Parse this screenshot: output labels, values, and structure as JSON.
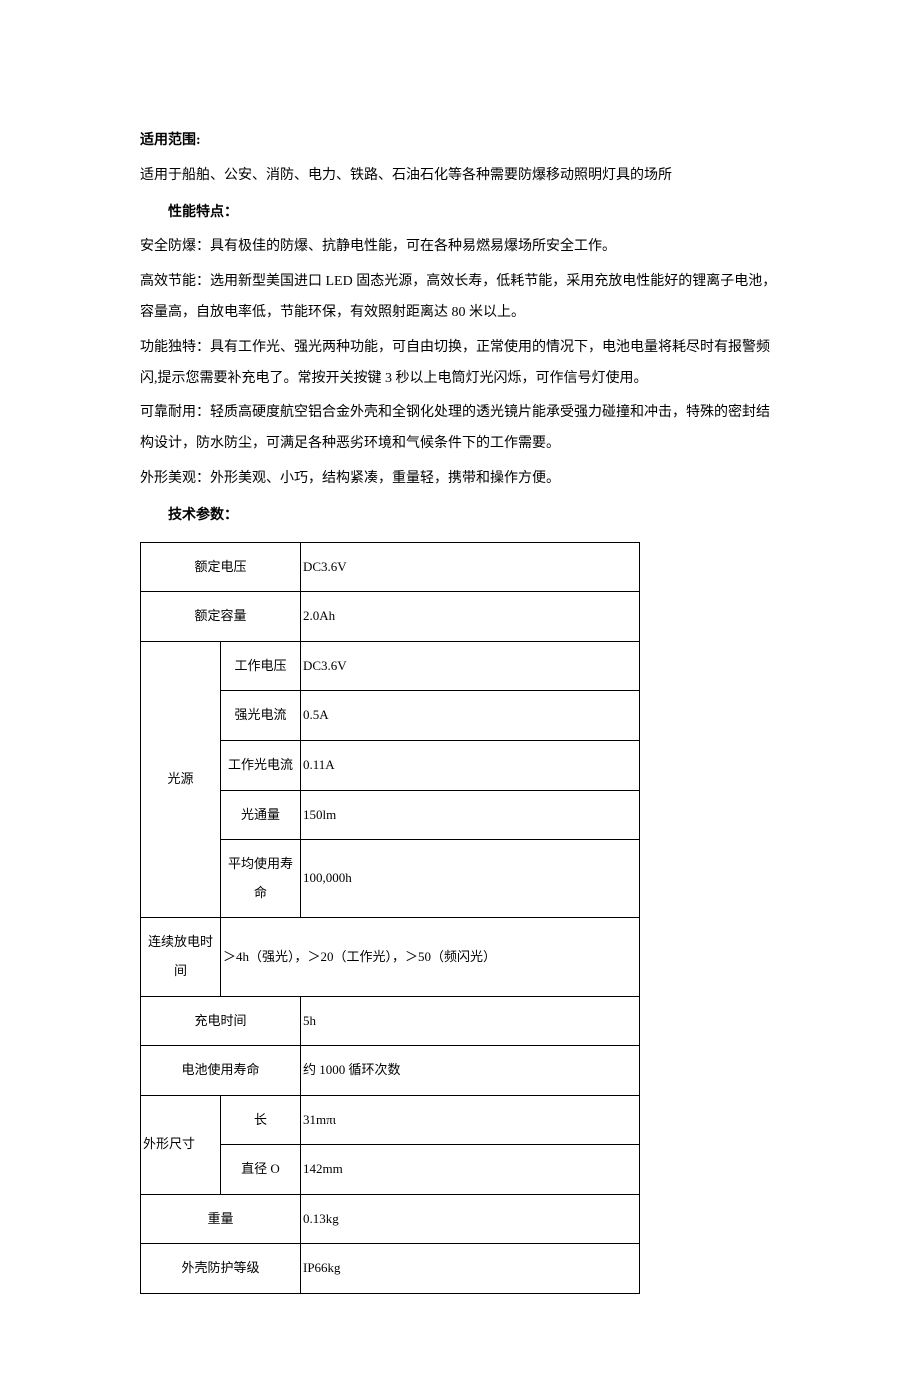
{
  "sections": {
    "scope": {
      "title": "适用范围:",
      "text": "适用于船舶、公安、消防、电力、铁路、石油石化等各种需要防爆移动照明灯具的场所"
    },
    "features": {
      "title": "性能特点：",
      "items": [
        "安全防爆：具有极佳的防爆、抗静电性能，可在各种易燃易爆场所安全工作。",
        "高效节能：选用新型美国进口 LED 固态光源，高效长寿，低耗节能，采用充放电性能好的锂离子电池，容量高，自放电率低，节能环保，有效照射距离达 80 米以上。",
        "功能独特：具有工作光、强光两种功能，可自由切换，正常使用的情况下，电池电量将耗尽时有报警频闪,提示您需要补充电了。常按开关按键 3 秒以上电筒灯光闪烁，可作信号灯使用。",
        "可靠耐用：轻质高硬度航空铝合金外壳和全钢化处理的透光镜片能承受强力碰撞和冲击，特殊的密封结构设计，防水防尘，可满足各种恶劣环境和气候条件下的工作需要。",
        "外形美观：外形美观、小巧，结构紧凑，重量轻，携带和操作方便。"
      ]
    },
    "specs": {
      "title": "技术参数：",
      "rated_voltage_label": "额定电压",
      "rated_voltage_value": "DC3.6V",
      "rated_capacity_label": "额定容量",
      "rated_capacity_value": "2.0Ah",
      "light_source_label": "光源",
      "working_voltage_label": "工作电压",
      "working_voltage_value": "DC3.6V",
      "strong_current_label": "强光电流",
      "strong_current_value": "0.5A",
      "working_current_label": "工作光电流",
      "working_current_value": "0.11A",
      "luminous_flux_label": "光通量",
      "luminous_flux_value": "150lm",
      "avg_life_label": "平均使用寿命",
      "avg_life_value": "100,000h",
      "discharge_time_label": "连续放电时间",
      "discharge_time_value": "＞4h（强光），＞20（工作光），＞50（频闪光）",
      "charge_time_label": "充电时间",
      "charge_time_value": "5h",
      "battery_life_label": "电池使用寿命",
      "battery_life_value": "约 1000 循环次数",
      "dimensions_label": "外形尺寸",
      "length_label": "长",
      "length_value": "31mπι",
      "diameter_label": "直径 O",
      "diameter_value": "142mm",
      "weight_label": "重量",
      "weight_value": "0.13kg",
      "protection_label": "外壳防护等级",
      "protection_value": "IP66kg"
    }
  }
}
